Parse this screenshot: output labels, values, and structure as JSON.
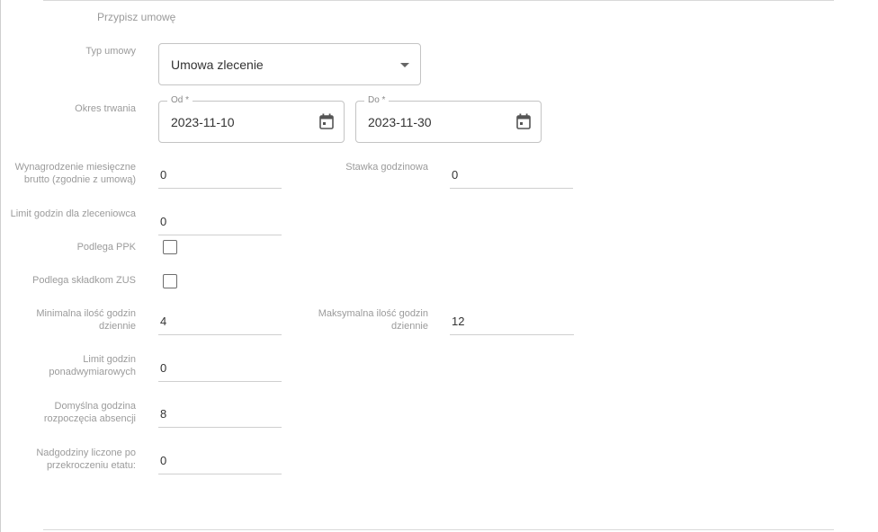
{
  "section": {
    "title": "Przypisz umowę"
  },
  "contract_type": {
    "label": "Typ umowy",
    "value": "Umowa zlecenie"
  },
  "duration": {
    "label": "Okres trwania",
    "from": {
      "legend": "Od *",
      "value": "2023-11-10"
    },
    "to": {
      "legend": "Do *",
      "value": "2023-11-30"
    }
  },
  "monthly_salary": {
    "label": "Wynagrodzenie miesięczne brutto (zgodnie z umową)",
    "value": "0"
  },
  "hourly_rate": {
    "label": "Stawka godzinowa",
    "value": "0"
  },
  "hours_limit": {
    "label": "Limit godzin dla zleceniowca",
    "value": "0"
  },
  "ppk": {
    "label": "Podlega PPK",
    "checked": false
  },
  "zus": {
    "label": "Podlega składkom ZUS",
    "checked": false
  },
  "min_hours": {
    "label": "Minimalna ilość godzin dziennie",
    "value": "4"
  },
  "max_hours": {
    "label": "Maksymalna ilość godzin dziennie",
    "value": "12"
  },
  "overtime_limit": {
    "label": "Limit godzin ponadwymiarowych",
    "value": "0"
  },
  "absence_start": {
    "label": "Domyślna godzina rozpoczęcia absencji",
    "value": "8"
  },
  "overtime_after": {
    "label": "Nadgodziny liczone po przekroczeniu etatu:",
    "value": "0"
  }
}
